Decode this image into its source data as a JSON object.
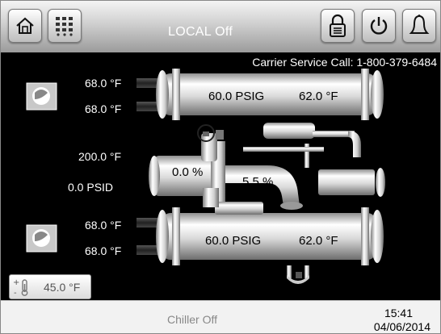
{
  "header": {
    "status": "LOCAL Off",
    "icons": [
      "home-icon",
      "menu-grid-icon",
      "lock-icon",
      "power-icon",
      "alarm-bell-icon"
    ]
  },
  "service_call": "Carrier Service Call: 1-800-379-6484",
  "condenser": {
    "water_in_temp": "68.0 °F",
    "water_out_temp": "68.0 °F",
    "pressure": "60.0 PSIG",
    "temperature": "62.0 °F"
  },
  "compressor": {
    "discharge_temp": "200.0 °F",
    "oil_pressure": "0.0 PSID",
    "load_left": "0.0 %",
    "load_right": "5.5 %"
  },
  "evaporator": {
    "water_in_temp": "68.0 °F",
    "water_out_temp": "68.0 °F",
    "pressure": "60.0 PSIG",
    "temperature": "62.0 °F"
  },
  "setpoint": {
    "value": "45.0 °F"
  },
  "footer": {
    "status": "Chiller Off",
    "time": "15:41",
    "date": "04/06/2014"
  }
}
